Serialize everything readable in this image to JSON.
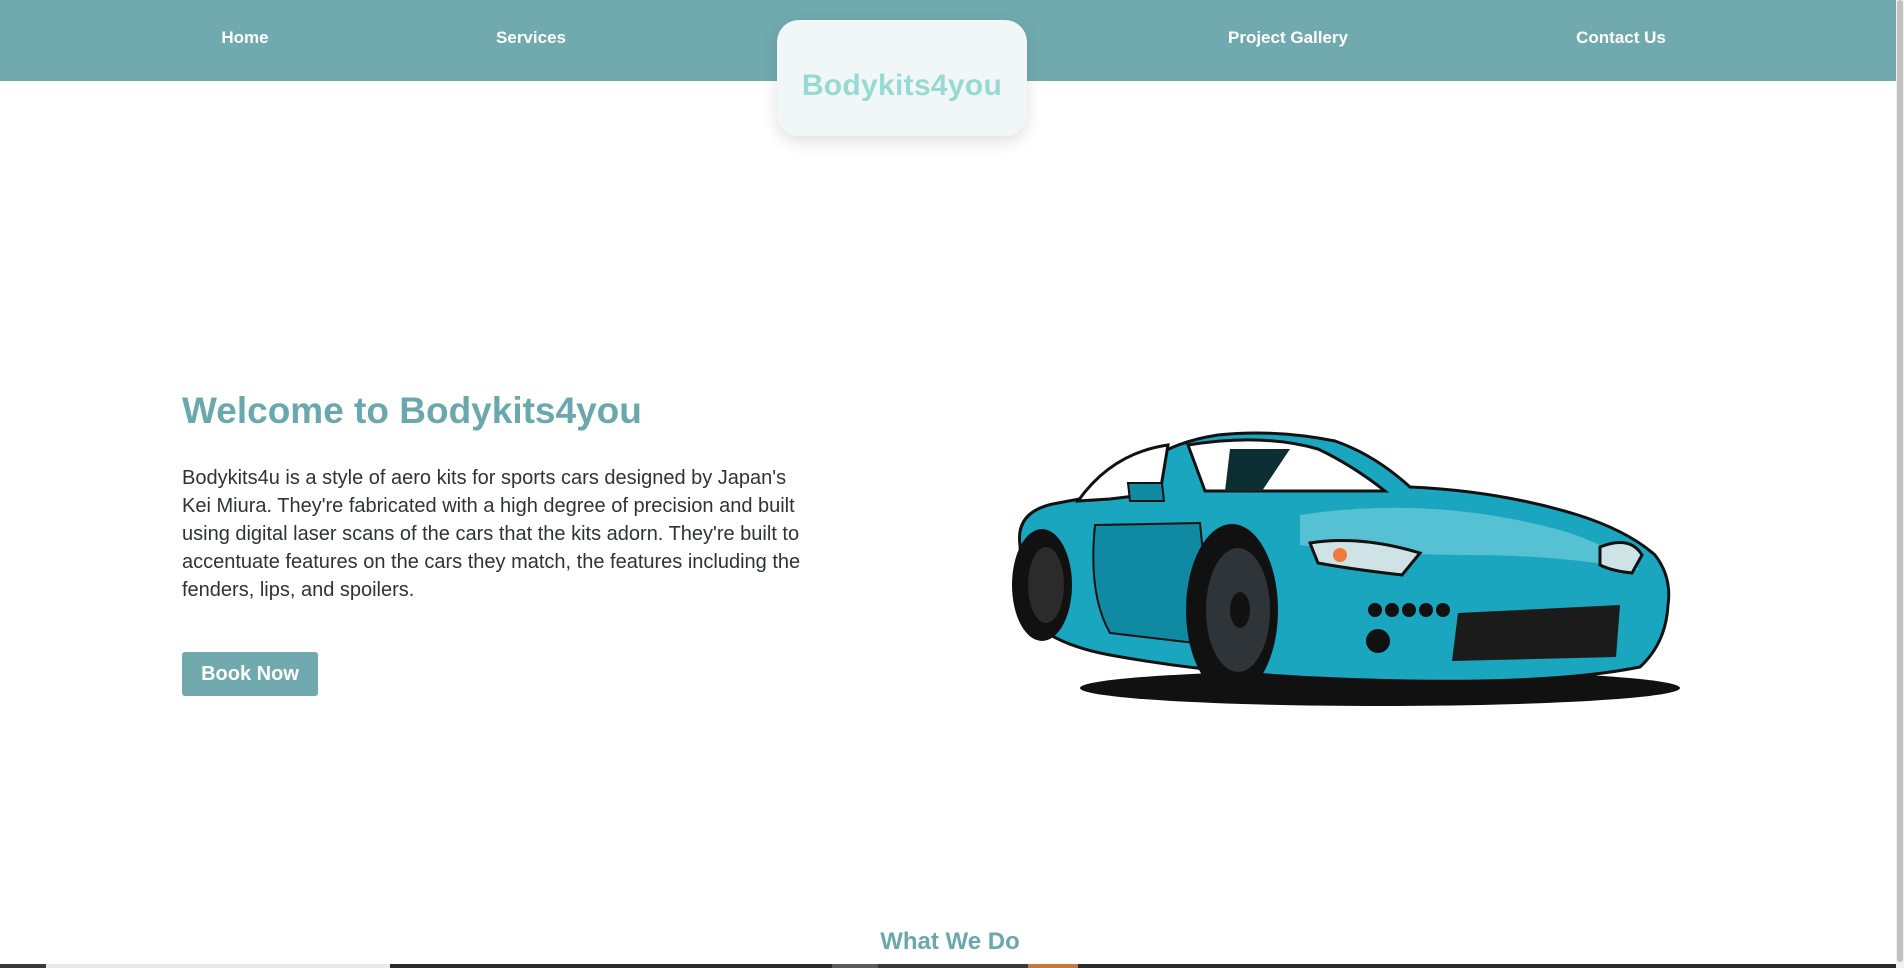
{
  "nav": {
    "home": "Home",
    "services": "Services",
    "gallery": "Project Gallery",
    "contact": "Contact Us",
    "logo": "Bodykits4you"
  },
  "hero": {
    "title": "Welcome to Bodykits4you",
    "description": "Bodykits4u is a style of aero kits for sports cars designed by Japan's Kei Miura. They're fabricated with a high degree of precision and built using digital laser scans of the cars that the kits adorn. They're built to accentuate features on the cars they match, the features including the fenders, lips, and spoilers.",
    "button": "Book Now",
    "image_icon": "sports-car-illustration"
  },
  "section": {
    "title": "What We Do"
  },
  "colors": {
    "nav_bg": "#70aaae",
    "logo_card_bg": "#f1f7f6",
    "logo_text": "#98d9d4",
    "heading": "#6aa8ae",
    "body_text": "#2e3336",
    "button_bg": "#70aaae",
    "car_body": "#1aa6bf"
  }
}
